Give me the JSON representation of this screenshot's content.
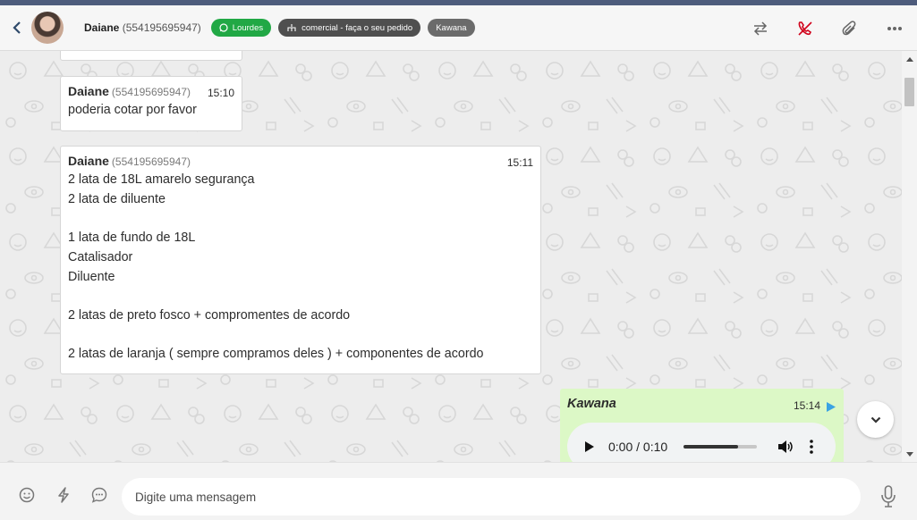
{
  "header": {
    "contact_name": "Daiane",
    "contact_phone": "(554195695947)",
    "tags": {
      "whatsapp": "Lourdes",
      "queue": "comercial - faça o seu pedido",
      "user": "Kawana"
    },
    "icons": [
      "back-icon",
      "transfer-icon",
      "end-call-icon",
      "attach-icon",
      "more-icon"
    ]
  },
  "messages": {
    "m0": {
      "sender": "Daiane",
      "phone": "(554195695947)",
      "time": "15:10",
      "text": "poderia cotar por favor"
    },
    "m1": {
      "sender": "Daiane",
      "phone": "(554195695947)",
      "time": "15:11",
      "lines": [
        "2 lata de 18L amarelo segurança",
        "2 lata de diluente",
        "",
        "1 lata de fundo de 18L",
        "Catalisador",
        "Diluente",
        "",
        "2 latas de preto fosco + compromentes de acordo",
        "",
        "2 latas de laranja ( sempre compramos deles ) + componentes de acordo"
      ]
    },
    "m2": {
      "sender": "Kawana",
      "time": "15:14",
      "audio": {
        "current_time": "0:00",
        "separator": " / ",
        "duration": "0:10",
        "progress": 0.74
      }
    }
  },
  "composer": {
    "placeholder": "Digite uma mensagem",
    "icons": [
      "emoji-icon",
      "quick-reply-icon",
      "chat-bubble-icon",
      "microphone-icon"
    ]
  },
  "colors": {
    "top_stripe": "#4e5c7c",
    "whatsapp_tag": "#21a845",
    "queue_tag": "#4f4f4f",
    "user_tag": "#6b6b6b",
    "outgoing_bubble": "#dcf8c6",
    "end_call": "#d0021b",
    "sent_arrow": "#3aa3e3"
  }
}
